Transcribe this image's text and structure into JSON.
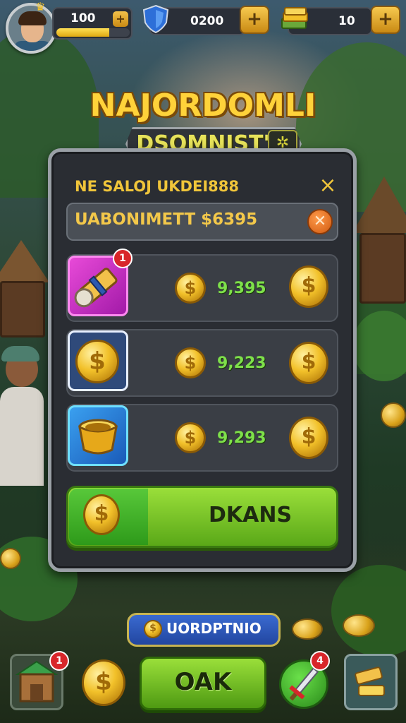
{
  "hud": {
    "xp_value": "100",
    "xp_progress": 0.72,
    "gems_value": "0200",
    "cash_value": "10",
    "plus_label": "+"
  },
  "title": {
    "main": "NAJORDOMLI",
    "sub": "DSOMNIST'"
  },
  "dialog": {
    "header": "NE SALOJ UKDEI888",
    "close_glyph": "×",
    "search_text": "UABONIMETT $6395",
    "items": [
      {
        "badge": "1",
        "price": "9,395"
      },
      {
        "badge": "",
        "price": "9,223"
      },
      {
        "badge": "",
        "price": "9,293"
      }
    ],
    "buy_label": "DKANS"
  },
  "bottom": {
    "pill_text": "UORDPTNIO",
    "shop_badge": "1",
    "action_badge": "4",
    "oak_label": "OAK"
  },
  "colors": {
    "accent_gold": "#f0c53a",
    "price_green": "#7ee04a",
    "button_green": "#5aa818"
  },
  "icons": {
    "coin": "dollar-coin-icon",
    "scroll": "scroll-item-icon",
    "pot": "gold-pot-icon",
    "shop": "shop-icon",
    "sword": "sword-icon",
    "cards": "cards-icon",
    "shield": "shield-gem-icon",
    "cash": "cash-stack-icon"
  }
}
